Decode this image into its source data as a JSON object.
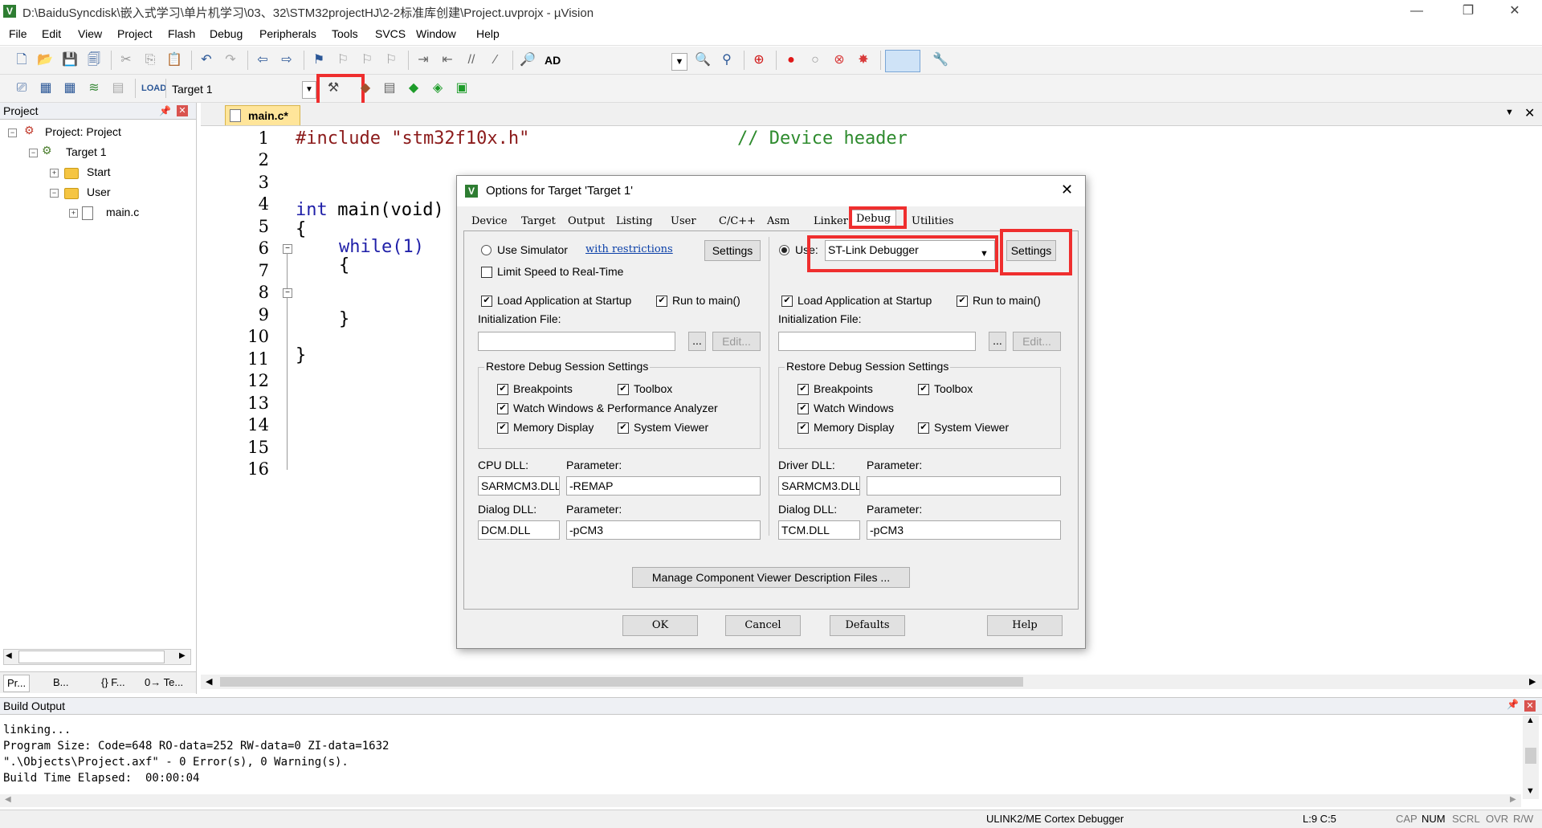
{
  "window": {
    "title": "D:\\BaiduSyncdisk\\嵌入式学习\\单片机学习\\03、32\\STM32projectHJ\\2-2标准库创建\\Project.uvprojx - µVision",
    "minimize": "—",
    "restore": "❐",
    "close": "✕"
  },
  "menu": [
    "File",
    "Edit",
    "View",
    "Project",
    "Flash",
    "Debug",
    "Peripherals",
    "Tools",
    "SVCS",
    "Window",
    "Help"
  ],
  "toolbar1": {
    "find_text": "AD"
  },
  "toolbar2": {
    "target": "Target 1"
  },
  "project_pane": {
    "title": "Project",
    "root": "Project: Project",
    "target": "Target 1",
    "groups": [
      "Start",
      "User"
    ],
    "file": "main.c",
    "tabs": [
      "Pr...",
      "B...",
      "{} F...",
      "0→ Te..."
    ]
  },
  "editor": {
    "tab": "main.c*",
    "lines": [
      "1",
      "2",
      "3",
      "4",
      "5",
      "6",
      "7",
      "8",
      "9",
      "10",
      "11",
      "12",
      "13",
      "14",
      "15",
      "16"
    ],
    "code_include": "#include \"stm32f10x.h\"",
    "code_comment": "// Device header",
    "code_int": "int",
    "code_main": " main(void)",
    "code_brace_open": "{",
    "code_while": "while(1)",
    "code_inner_open": "{",
    "code_inner_close": "}",
    "code_brace_close": "}"
  },
  "dialog": {
    "title": "Options for Target 'Target 1'",
    "tabs": [
      "Device",
      "Target",
      "Output",
      "Listing",
      "User",
      "C/C++",
      "Asm",
      "Linker",
      "Debug",
      "Utilities"
    ],
    "left": {
      "use_simulator": "Use Simulator",
      "with_restrictions": "with restrictions",
      "settings": "Settings",
      "limit_speed": "Limit Speed to Real-Time",
      "load_app": "Load Application at Startup",
      "run_main": "Run to main()",
      "init_file": "Initialization File:",
      "browse": "...",
      "edit": "Edit...",
      "restore_group": "Restore Debug Session Settings",
      "breakpoints": "Breakpoints",
      "toolbox": "Toolbox",
      "watch": "Watch Windows & Performance Analyzer",
      "memory": "Memory Display",
      "sysviewer": "System Viewer",
      "dll_label": "CPU DLL:",
      "param_label": "Parameter:",
      "dll_value": "SARMCM3.DLL",
      "param_value": "-REMAP",
      "dialog_dll_label": "Dialog DLL:",
      "dialog_param_label": "Parameter:",
      "dialog_dll_value": "DCM.DLL",
      "dialog_param_value": "-pCM3"
    },
    "right": {
      "use": "Use:",
      "debugger": "ST-Link Debugger",
      "settings": "Settings",
      "load_app": "Load Application at Startup",
      "run_main": "Run to main()",
      "init_file": "Initialization File:",
      "browse": "...",
      "edit": "Edit...",
      "restore_group": "Restore Debug Session Settings",
      "breakpoints": "Breakpoints",
      "toolbox": "Toolbox",
      "watch": "Watch Windows",
      "memory": "Memory Display",
      "sysviewer": "System Viewer",
      "dll_label": "Driver DLL:",
      "param_label": "Parameter:",
      "dll_value": "SARMCM3.DLL",
      "param_value": "",
      "dialog_dll_label": "Dialog DLL:",
      "dialog_param_label": "Parameter:",
      "dialog_dll_value": "TCM.DLL",
      "dialog_param_value": "-pCM3"
    },
    "manage": "Manage Component Viewer Description Files ...",
    "ok": "OK",
    "cancel": "Cancel",
    "defaults": "Defaults",
    "help": "Help"
  },
  "build_output": {
    "title": "Build Output",
    "lines": [
      "linking...",
      "Program Size: Code=648 RO-data=252 RW-data=0 ZI-data=1632",
      "\".\\Objects\\Project.axf\" - 0 Error(s), 0 Warning(s).",
      "Build Time Elapsed:  00:00:04"
    ]
  },
  "status": {
    "debugger": "ULINK2/ME Cortex Debugger",
    "position": "L:9 C:5",
    "caps": "CAP",
    "num": "NUM",
    "scrl": "SCRL",
    "ovr": "OVR",
    "rw": "R/W"
  },
  "colors": {
    "highlight_box": "#ef2e2e",
    "keyword": "#1f1fa8",
    "string": "#8b1a1a",
    "comment": "#2e8b2e",
    "tab_active": "#ffe59a"
  }
}
